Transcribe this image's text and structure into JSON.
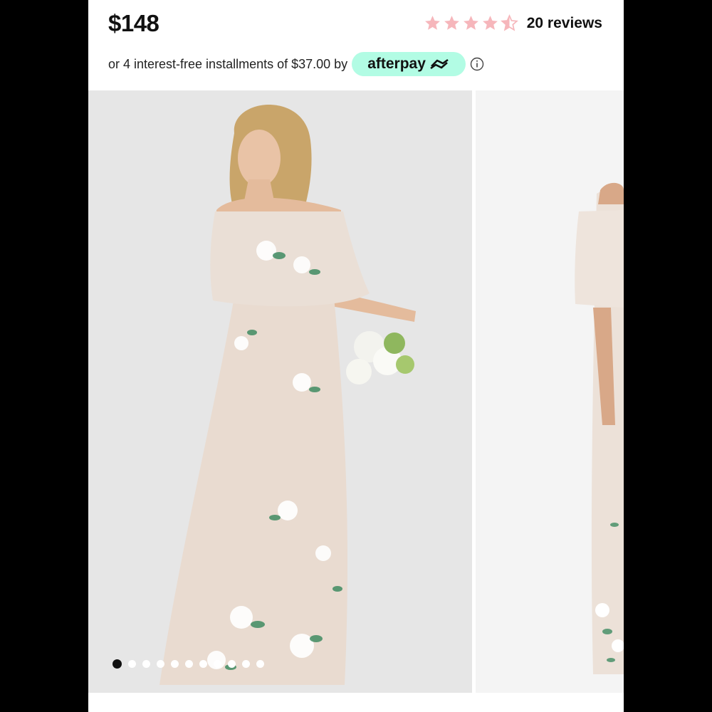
{
  "product": {
    "price": "$148",
    "rating_value": 4.5,
    "rating_max": 5,
    "reviews_label": "20 reviews"
  },
  "payment": {
    "installments_text": "or 4 interest-free installments of $37.00 by",
    "provider_label": "afterpay",
    "provider_icon": "afterpay-arrows-icon",
    "info_icon": "info-circle-icon"
  },
  "gallery": {
    "main_image_alt": "model-in-floral-off-shoulder-maxi-dress",
    "next_image_alt": "dress-side-view",
    "slide_count": 11,
    "active_slide": 1
  },
  "colors": {
    "star": "#f6b6bb",
    "afterpay_bg": "#b2fce4",
    "page_bg": "#000000"
  }
}
